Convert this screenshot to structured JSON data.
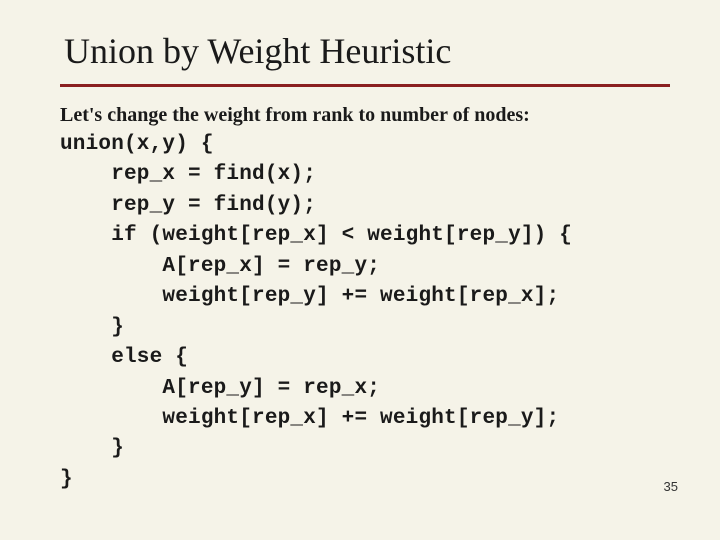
{
  "title": "Union by Weight Heuristic",
  "intro": "Let's change the weight from rank to number of nodes:",
  "code_lines": [
    "union(x,y) {",
    "    rep_x = find(x);",
    "    rep_y = find(y);",
    "    if (weight[rep_x] < weight[rep_y]) {",
    "        A[rep_x] = rep_y;",
    "        weight[rep_y] += weight[rep_x];",
    "    }",
    "    else {",
    "        A[rep_y] = rep_x;",
    "        weight[rep_x] += weight[rep_y];",
    "    }",
    "}"
  ],
  "page_number": "35"
}
